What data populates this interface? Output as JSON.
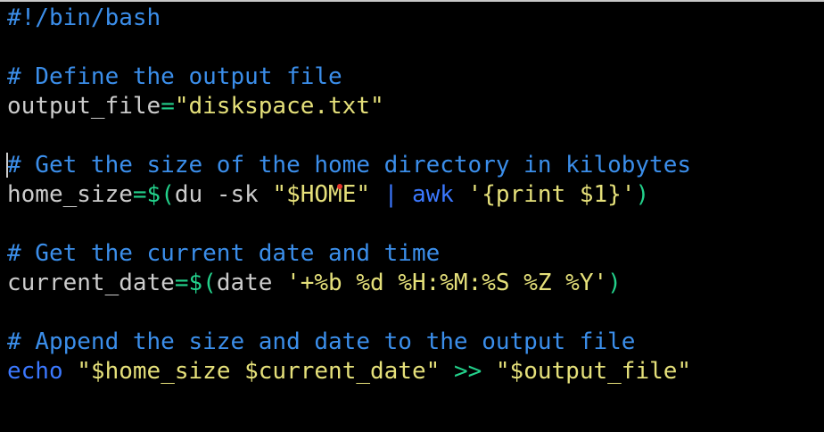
{
  "colors": {
    "background": "#000000",
    "comment": "#3b8eea",
    "keyword": "#3b8eea",
    "string": "#e5e07a",
    "operator": "#23d18b",
    "default": "#cccccc",
    "pipe": "#3b78ff"
  },
  "editor": {
    "lines": [
      {
        "tokens": [
          {
            "text": "#!/bin/bash",
            "color": "#3b8eea"
          }
        ]
      },
      {
        "tokens": []
      },
      {
        "tokens": [
          {
            "text": "# Define the output file",
            "color": "#3b8eea"
          }
        ]
      },
      {
        "tokens": [
          {
            "text": "output_file",
            "color": "#cccccc"
          },
          {
            "text": "=",
            "color": "#23d18b"
          },
          {
            "text": "\"diskspace.txt\"",
            "color": "#e5e07a"
          }
        ]
      },
      {
        "tokens": []
      },
      {
        "tokens": [
          {
            "text": "# Get the size of the home directory in kilobytes",
            "color": "#3b8eea"
          }
        ]
      },
      {
        "tokens": [
          {
            "text": "home_size",
            "color": "#cccccc"
          },
          {
            "text": "=$(",
            "color": "#23d18b"
          },
          {
            "text": "du -sk ",
            "color": "#cccccc"
          },
          {
            "text": "\"$HOME\"",
            "color": "#e5e07a"
          },
          {
            "text": " ",
            "color": "#cccccc"
          },
          {
            "text": "|",
            "color": "#3b78ff"
          },
          {
            "text": " ",
            "color": "#cccccc"
          },
          {
            "text": "awk",
            "color": "#3b78ff"
          },
          {
            "text": " ",
            "color": "#cccccc"
          },
          {
            "text": "'{print $1}'",
            "color": "#e5e07a"
          },
          {
            "text": ")",
            "color": "#23d18b"
          }
        ]
      },
      {
        "tokens": []
      },
      {
        "tokens": [
          {
            "text": "# Get the current date and time",
            "color": "#3b8eea"
          }
        ]
      },
      {
        "tokens": [
          {
            "text": "current_date",
            "color": "#cccccc"
          },
          {
            "text": "=$(",
            "color": "#23d18b"
          },
          {
            "text": "date ",
            "color": "#cccccc"
          },
          {
            "text": "'+%b %d %H:%M:%S %Z %Y'",
            "color": "#e5e07a"
          },
          {
            "text": ")",
            "color": "#23d18b"
          }
        ]
      },
      {
        "tokens": []
      },
      {
        "tokens": [
          {
            "text": "# Append the size and date to the output file",
            "color": "#3b8eea"
          }
        ]
      },
      {
        "tokens": [
          {
            "text": "echo",
            "color": "#3b78ff"
          },
          {
            "text": " ",
            "color": "#cccccc"
          },
          {
            "text": "\"$home_size $current_date\"",
            "color": "#e5e07a"
          },
          {
            "text": " ",
            "color": "#cccccc"
          },
          {
            "text": ">>",
            "color": "#23d18b"
          },
          {
            "text": " ",
            "color": "#cccccc"
          },
          {
            "text": "\"$output_file\"",
            "color": "#e5e07a"
          }
        ]
      }
    ]
  }
}
